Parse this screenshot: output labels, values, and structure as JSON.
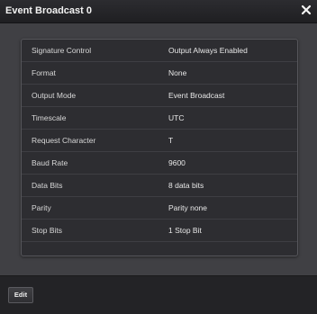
{
  "dialog": {
    "title": "Event Broadcast 0",
    "close_icon": "close-x-icon"
  },
  "settings": [
    {
      "label": "Signature Control",
      "value": "Output Always Enabled"
    },
    {
      "label": "Format",
      "value": "None"
    },
    {
      "label": "Output Mode",
      "value": "Event Broadcast"
    },
    {
      "label": "Timescale",
      "value": "UTC"
    },
    {
      "label": "Request Character",
      "value": "T"
    },
    {
      "label": "Baud Rate",
      "value": "9600"
    },
    {
      "label": "Data Bits",
      "value": "8 data bits"
    },
    {
      "label": "Parity",
      "value": "Parity none"
    },
    {
      "label": "Stop Bits",
      "value": "1 Stop Bit"
    }
  ],
  "footer": {
    "edit_label": "Edit"
  }
}
